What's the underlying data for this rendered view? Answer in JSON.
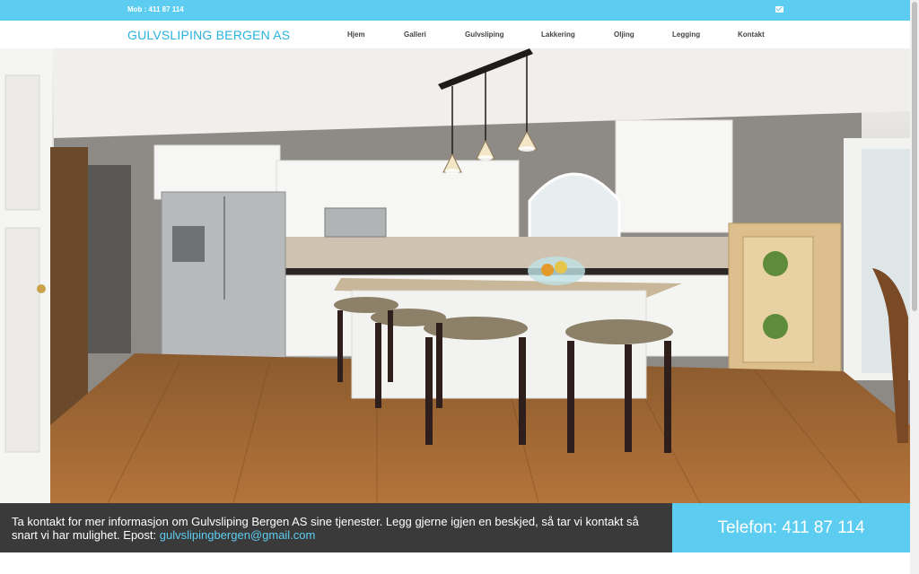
{
  "topbar": {
    "mobile": "Mob : 411 87 114",
    "mail_icon": "envelope-icon"
  },
  "header": {
    "brand": "GULVSLIPING BERGEN AS",
    "nav": [
      {
        "label": "Hjem"
      },
      {
        "label": "Galleri"
      },
      {
        "label": "Gulvsliping"
      },
      {
        "label": "Lakkering"
      },
      {
        "label": "Oljing"
      },
      {
        "label": "Legging"
      },
      {
        "label": "Kontakt"
      }
    ]
  },
  "hero": {
    "image": "kitchen-photo"
  },
  "info": {
    "text": "Ta kontakt for mer informasjon om Gulvsliping Bergen AS sine tjenester. Legg gjerne igjen en beskjed, så tar vi kontakt så snart vi har mulighet. Epost: ",
    "email": "gulvslipingbergen@gmail.com"
  },
  "phone": {
    "label": "Telefon: 411 87 114"
  },
  "colors": {
    "accent": "#5ccdf0",
    "brand": "#29b2dc",
    "dark_bar": "#3a3a3a"
  }
}
